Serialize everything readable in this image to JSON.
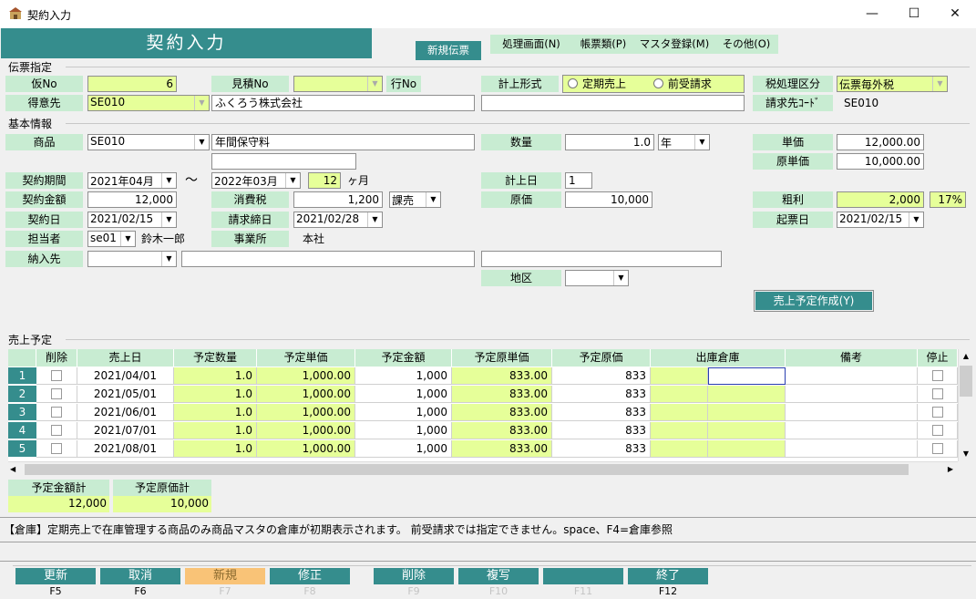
{
  "window": {
    "title": "契約入力",
    "minimize": "—",
    "maximize": "☐",
    "close": "✕"
  },
  "banner": "契約入力",
  "menu": {
    "new_slip": "新規伝票",
    "process": "処理画面(N)",
    "forms": "帳票類(P)",
    "master": "マスタ登録(M)",
    "other": "その他(O)"
  },
  "slip": {
    "section": "伝票指定",
    "kari_no_label": "仮No",
    "kari_no": "6",
    "mitsumori_label": "見積No",
    "mitsumori": "",
    "gyo_label": "行No",
    "keijo_label": "計上形式",
    "radio1": "定期売上",
    "radio2": "前受請求",
    "tax_label": "税処理区分",
    "tax": "伝票毎外税",
    "tokui_label": "得意先",
    "tokui_code": "SE010",
    "tokui_name": "ふくろう株式会社",
    "tokui_extra": "",
    "seikyu_label": "請求先ｺｰﾄﾞ",
    "seikyu": "SE010"
  },
  "basic": {
    "section": "基本情報",
    "shohin_label": "商品",
    "shohin_code": "SE010",
    "shohin_name": "年間保守料",
    "shohin_extra": "",
    "suryo_label": "数量",
    "suryo": "1.0",
    "unit": "年",
    "tanka_label": "単価",
    "tanka": "12,000.00",
    "gentanka_label": "原単価",
    "gentanka": "10,000.00",
    "kikan_label": "契約期間",
    "kikan_from": "2021年04月",
    "tilde": "～",
    "kikan_to": "2022年03月",
    "months": "12",
    "months_unit": "ヶ月",
    "keijobi_label": "計上日",
    "keijobi": "1",
    "kingaku_label": "契約金額",
    "kingaku": "12,000",
    "tax_label": "消費税",
    "tax": "1,200",
    "tax_type": "課売",
    "genka_label": "原価",
    "genka": "10,000",
    "arari_label": "粗利",
    "arari": "2,000",
    "arari_pct": "17%",
    "keiyakubi_label": "契約日",
    "keiyakubi": "2021/02/15",
    "shimebi_label": "請求締日",
    "shimebi": "2021/02/28",
    "kihyobi_label": "起票日",
    "kihyobi": "2021/02/15",
    "tanto_label": "担当者",
    "tanto_code": "se01",
    "tanto_name": "鈴木一郎",
    "jigyo_label": "事業所",
    "jigyo": "本社",
    "nonyu_label": "納入先",
    "nonyu_code": "",
    "nonyu_name": "",
    "nonyu_extra": "",
    "chiku_label": "地区",
    "chiku": "",
    "create_btn": "売上予定作成(Y)"
  },
  "schedule": {
    "section": "売上予定",
    "headers": [
      "削除",
      "売上日",
      "予定数量",
      "予定単価",
      "予定金額",
      "予定原単価",
      "予定原価",
      "出庫倉庫",
      "備考",
      "停止"
    ],
    "rows": [
      {
        "no": "1",
        "date": "2021/04/01",
        "qty": "1.0",
        "price": "1,000.00",
        "amount": "1,000",
        "cost_unit": "833.00",
        "cost": "833"
      },
      {
        "no": "2",
        "date": "2021/05/01",
        "qty": "1.0",
        "price": "1,000.00",
        "amount": "1,000",
        "cost_unit": "833.00",
        "cost": "833"
      },
      {
        "no": "3",
        "date": "2021/06/01",
        "qty": "1.0",
        "price": "1,000.00",
        "amount": "1,000",
        "cost_unit": "833.00",
        "cost": "833"
      },
      {
        "no": "4",
        "date": "2021/07/01",
        "qty": "1.0",
        "price": "1,000.00",
        "amount": "1,000",
        "cost_unit": "833.00",
        "cost": "833"
      },
      {
        "no": "5",
        "date": "2021/08/01",
        "qty": "1.0",
        "price": "1,000.00",
        "amount": "1,000",
        "cost_unit": "833.00",
        "cost": "833"
      }
    ],
    "total_amount_label": "予定金額計",
    "total_amount": "12,000",
    "total_cost_label": "予定原価計",
    "total_cost": "10,000"
  },
  "help": "【倉庫】定期売上で在庫管理する商品のみ商品マスタの倉庫が初期表示されます。 前受請求では指定できません。space、F4=倉庫参照",
  "fkeys": [
    {
      "label": "更新",
      "key": "F5"
    },
    {
      "label": "取消",
      "key": "F6"
    },
    {
      "label": "新規",
      "key": "F7"
    },
    {
      "label": "修正",
      "key": "F8"
    },
    {
      "label": "削除",
      "key": "F9"
    },
    {
      "label": "複写",
      "key": "F10"
    },
    {
      "label": "",
      "key": "F11"
    },
    {
      "label": "終了",
      "key": "F12"
    }
  ]
}
